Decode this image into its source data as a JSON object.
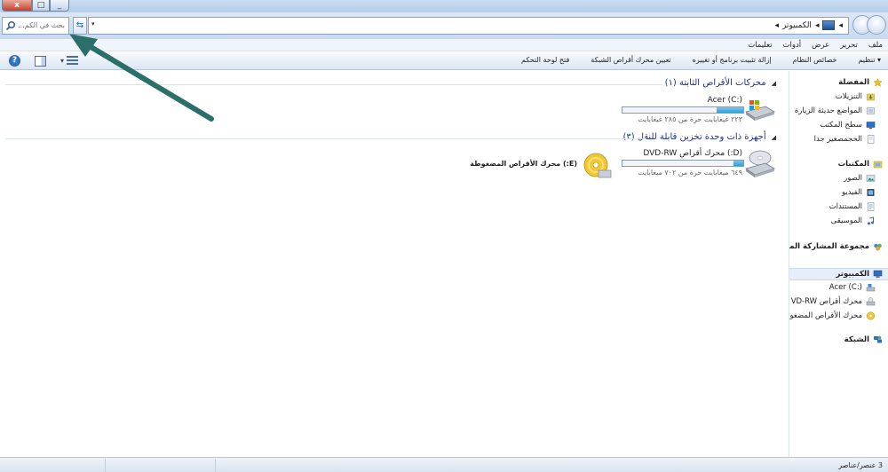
{
  "window": {
    "close_glyph": "x",
    "max_glyph": "□",
    "min_glyph": "_"
  },
  "address": {
    "path": [
      "الكمبيوتر"
    ],
    "separator": "◂",
    "dropdown_glyph": "▾",
    "refresh_glyph": "⇆"
  },
  "search": {
    "placeholder": "بحث في الكم..."
  },
  "menu": [
    "ملف",
    "تحرير",
    "عرض",
    "أدوات",
    "تعليمات"
  ],
  "toolbar": {
    "items": [
      "تنظيم ▾",
      "خصائص النظام",
      "إزالة تثبيت برنامج أو تغييره",
      "تعيين محرك أقراص الشبكة",
      "فتح لوحة التحكم"
    ],
    "view_dd": "▾",
    "help_glyph": "?"
  },
  "nav": {
    "favorites": "المفضلة",
    "downloads": "التنزيلات",
    "recent": "المواضع حديثة الزيارة",
    "desktop": "سطح المكتب",
    "other": "الحجمصغير جدا",
    "libraries": "المكتبات",
    "pictures": "الصور",
    "videos": "الفيديو",
    "documents": "المستندات",
    "music": "الموسيقى",
    "homegroup": "مجموعة المشاركة المنزل",
    "computer": "الكمبيوتر",
    "drive_c": "Acer (C:)",
    "drive_d": "محرك أقراص VD-RW",
    "drive_e": "محرك الأقراص المضغو",
    "network": "الشبكة"
  },
  "groups": {
    "fixed": "محركات الأقراص الثابتة (١)",
    "removable": "أجهزة ذات وحدة تخزين قابلة للنقل (٣)",
    "collapse_glyph": "◢"
  },
  "drives": {
    "c": {
      "name": "Acer (C:)",
      "free": "٢٢٣ غيغابايت حرة من ٢٨٥ غيغابايت",
      "used_fraction": 0.22
    },
    "d": {
      "name": "(D:) محرك أقراص DVD-RW",
      "free": "٦٤٩ ميغابايت حرة من ٧٠٢ ميغابايت",
      "used_fraction": 0.08
    },
    "e": {
      "name": "(E:) محرك الأقراص المضغوطة"
    }
  },
  "status": {
    "count": "3 عنصر/عناصر"
  },
  "colors": {
    "arrow": "#2a6f6a",
    "group_head": "#1e3287",
    "bar_fill": "#26a0da"
  }
}
